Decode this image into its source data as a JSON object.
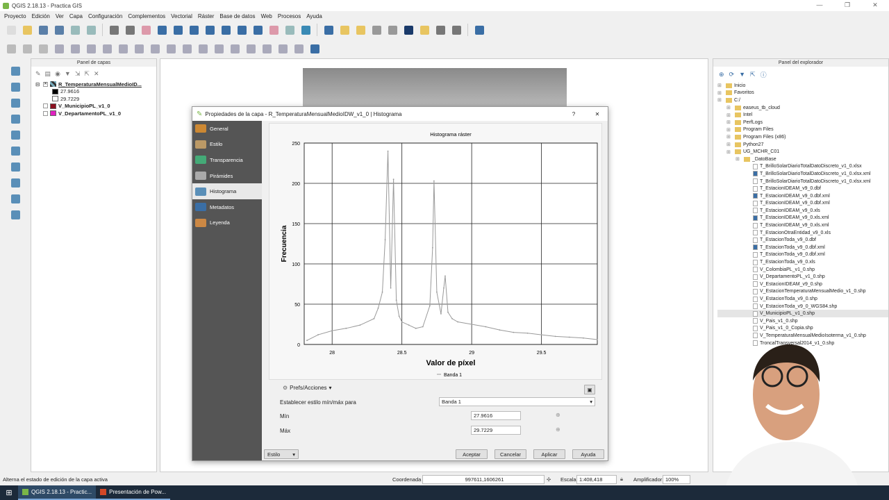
{
  "window": {
    "title": "QGIS 2.18.13 - Practica GIS"
  },
  "menu": [
    "Proyecto",
    "Edición",
    "Ver",
    "Capa",
    "Configuración",
    "Complementos",
    "Vectorial",
    "Ráster",
    "Base de datos",
    "Web",
    "Procesos",
    "Ayuda"
  ],
  "layers_panel": {
    "title": "Panel de capas",
    "layers": [
      {
        "name": "R_TemperaturaMensualMedioID...",
        "checked": true,
        "bold": true,
        "underline": true
      },
      {
        "name": "27.9616",
        "swatch": "#000000"
      },
      {
        "name": "29.7229",
        "swatch": "#ffffff"
      },
      {
        "name": "V_MunicipioPL_v1_0",
        "checked": false,
        "swatch": "#8b1020"
      },
      {
        "name": "V_DepartamentoPL_v1_0",
        "checked": false,
        "swatch": "#e020c0"
      }
    ]
  },
  "explorer": {
    "title": "Panel del explorador",
    "items": [
      {
        "t": "Inicio",
        "lvl": 0,
        "k": "f"
      },
      {
        "t": "Favoritos",
        "lvl": 0,
        "k": "f"
      },
      {
        "t": "C:/",
        "lvl": 0,
        "k": "f"
      },
      {
        "t": "easeus_tb_cloud",
        "lvl": 1,
        "k": "f"
      },
      {
        "t": "Intel",
        "lvl": 1,
        "k": "f"
      },
      {
        "t": "PerfLogs",
        "lvl": 1,
        "k": "f"
      },
      {
        "t": "Program Files",
        "lvl": 1,
        "k": "f"
      },
      {
        "t": "Program Files (x86)",
        "lvl": 1,
        "k": "f"
      },
      {
        "t": "Python27",
        "lvl": 1,
        "k": "f"
      },
      {
        "t": "UG_MCHR_C01",
        "lvl": 1,
        "k": "f"
      },
      {
        "t": "_DatoBase",
        "lvl": 2,
        "k": "f"
      },
      {
        "t": "T_BrilloSolarDiarioTotalDatoDiscreto_v1_0.xlsx",
        "lvl": 3,
        "k": "d"
      },
      {
        "t": "T_BrilloSolarDiarioTotalDatoDiscreto_v1_0.xlsx.xml",
        "lvl": 3,
        "k": "g"
      },
      {
        "t": "T_BrilloSolarDiarioTotalDatoDiscreto_v1_0.xlsx.xml",
        "lvl": 3,
        "k": "d"
      },
      {
        "t": "T_EstacionIDEAM_v9_0.dbf",
        "lvl": 3,
        "k": "d"
      },
      {
        "t": "T_EstacionIDEAM_v9_0.dbf.xml",
        "lvl": 3,
        "k": "g"
      },
      {
        "t": "T_EstacionIDEAM_v9_0.dbf.xml",
        "lvl": 3,
        "k": "d"
      },
      {
        "t": "T_EstacionIDEAM_v9_0.xls",
        "lvl": 3,
        "k": "d"
      },
      {
        "t": "T_EstacionIDEAM_v9_0.xls.xml",
        "lvl": 3,
        "k": "g"
      },
      {
        "t": "T_EstacionIDEAM_v9_0.xls.xml",
        "lvl": 3,
        "k": "d"
      },
      {
        "t": "T_EstacionOtraEntidad_v9_0.xls",
        "lvl": 3,
        "k": "d"
      },
      {
        "t": "T_EstacionToda_v9_0.dbf",
        "lvl": 3,
        "k": "d"
      },
      {
        "t": "T_EstacionToda_v9_0.dbf.xml",
        "lvl": 3,
        "k": "g"
      },
      {
        "t": "T_EstacionToda_v9_0.dbf.xml",
        "lvl": 3,
        "k": "d"
      },
      {
        "t": "T_EstacionToda_v9_0.xls",
        "lvl": 3,
        "k": "d"
      },
      {
        "t": "V_ColombiaPL_v1_0.shp",
        "lvl": 3,
        "k": "d"
      },
      {
        "t": "V_DepartamentoPL_v1_0.shp",
        "lvl": 3,
        "k": "d"
      },
      {
        "t": "V_EstacionIDEAM_v9_0.shp",
        "lvl": 3,
        "k": "d"
      },
      {
        "t": "V_EstacionTemperaturaMensualMedio_v1_0.shp",
        "lvl": 3,
        "k": "d"
      },
      {
        "t": "V_EstacionToda_v9_0.shp",
        "lvl": 3,
        "k": "d"
      },
      {
        "t": "V_EstacionToda_v9_0_WGS84.shp",
        "lvl": 3,
        "k": "d"
      },
      {
        "t": "V_MunicipioPL_v1_0.shp",
        "lvl": 3,
        "k": "d",
        "sel": true
      },
      {
        "t": "V_Pais_v1_0.shp",
        "lvl": 3,
        "k": "d"
      },
      {
        "t": "V_Pais_v1_0_Copia.shp",
        "lvl": 3,
        "k": "d"
      },
      {
        "t": "V_TemperaturaMensualMedioIsoterma_v1_0.shp",
        "lvl": 3,
        "k": "d"
      },
      {
        "t": "TroncalTransversal2014_v1_0.shp",
        "lvl": 3,
        "k": "d"
      }
    ]
  },
  "dialog": {
    "title": "Propiedades de la capa - R_TemperaturaMensualMedioIDW_v1_0 | Histograma",
    "help": "?",
    "close": "✕",
    "sidebar": [
      "General",
      "Estilo",
      "Transparencia",
      "Pirámides",
      "Histograma",
      "Metadatos",
      "Leyenda"
    ],
    "active": "Histograma",
    "prefs": "Prefs/Acciones",
    "minmax_label": "Establecer estilo mín/máx para",
    "band_select": "Banda 1",
    "min_label": "Mín",
    "min_value": "27.9616",
    "max_label": "Máx",
    "max_value": "29.7229",
    "buttons": {
      "style": "Estilo",
      "accept": "Aceptar",
      "cancel": "Cancelar",
      "apply": "Aplicar",
      "help": "Ayuda"
    }
  },
  "chart_data": {
    "type": "line",
    "title": "Histograma ráster",
    "xlabel": "Valor de píxel",
    "ylabel": "Frecuencia",
    "xlim": [
      27.8,
      29.9
    ],
    "ylim": [
      0,
      250
    ],
    "xticks": [
      "28",
      "28.5",
      "29",
      "29.5"
    ],
    "yticks": [
      "0",
      "50",
      "100",
      "150",
      "200",
      "250"
    ],
    "grid": true,
    "legend_position": "bottom",
    "series": [
      {
        "name": "Banda 1",
        "color": "#999999",
        "x": [
          27.82,
          27.9,
          28.0,
          28.1,
          28.2,
          28.3,
          28.33,
          28.36,
          28.38,
          28.4,
          28.42,
          28.44,
          28.46,
          28.48,
          28.5,
          28.55,
          28.6,
          28.65,
          28.7,
          28.72,
          28.73,
          28.75,
          28.78,
          28.8,
          28.81,
          28.83,
          28.86,
          28.9,
          29.0,
          29.1,
          29.2,
          29.3,
          29.4,
          29.5,
          29.6,
          29.7,
          29.8,
          29.9
        ],
        "y": [
          5,
          12,
          17,
          20,
          24,
          32,
          45,
          65,
          130,
          240,
          70,
          205,
          55,
          35,
          28,
          24,
          20,
          22,
          48,
          120,
          203,
          65,
          38,
          70,
          85,
          40,
          32,
          28,
          25,
          22,
          18,
          15,
          14,
          12,
          10,
          9,
          8,
          6
        ]
      }
    ]
  },
  "status": {
    "hint": "Alterna el estado de edición de la capa activa",
    "coord_label": "Coordenada",
    "coord": "997611,1606261",
    "scale_label": "Escala",
    "scale": "1:408,418",
    "amp_label": "Amplificador",
    "amp": "100%"
  },
  "taskbar": [
    "QGIS 2.18.13 - Practic...",
    "Presentación de Pow..."
  ],
  "colors": {
    "accent": "#3a6ea5",
    "sidebar": "#555555"
  }
}
